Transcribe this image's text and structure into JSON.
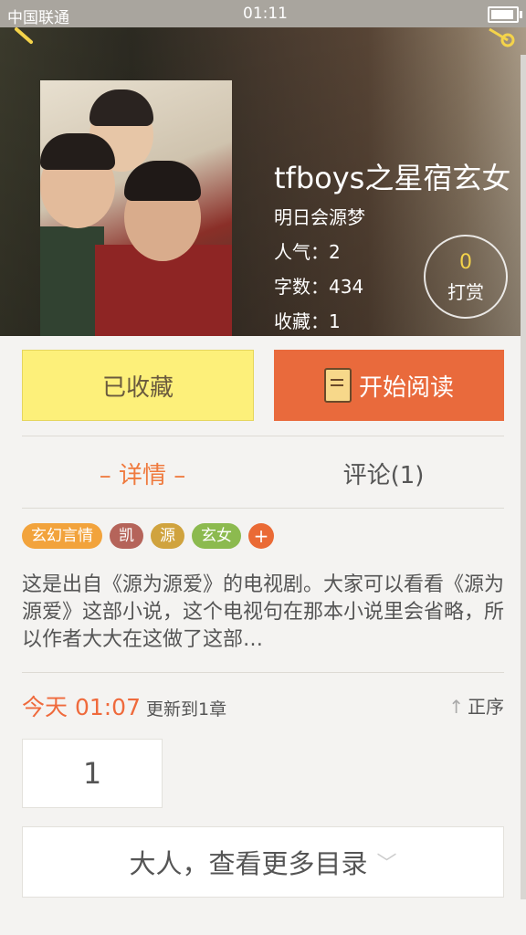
{
  "status_bar": {
    "carrier": "中国联通",
    "time": "01:11"
  },
  "book": {
    "title": "tfboys之星宿玄女",
    "author": "明日会源梦",
    "stats": {
      "popularity": "人气：2",
      "word_count": "字数：434",
      "favorites": "收藏：1"
    },
    "tip": {
      "count": "0",
      "label": "打赏"
    }
  },
  "actions": {
    "collected_label": "已收藏",
    "read_label": "开始阅读"
  },
  "tabs": [
    {
      "label": "– 详情 –"
    },
    {
      "label": "评论(1)"
    }
  ],
  "tags": [
    {
      "label": "玄幻言情",
      "color": "#f2a33c"
    },
    {
      "label": "凯",
      "color": "#b5645a"
    },
    {
      "label": "源",
      "color": "#d0a33e"
    },
    {
      "label": "玄女",
      "color": "#8cba4f"
    },
    {
      "label": "+",
      "color": "#ea6a35"
    }
  ],
  "description": "这是出自《源为源爱》的电视剧。大家可以看看《源为源爱》这部小说，这个电视句在那本小说里会省略，所以作者大大在这做了这部…",
  "update": {
    "when": "今天 01:07",
    "message": "更新到1章",
    "order_label": "正序"
  },
  "chapter": {
    "number": "1"
  },
  "more_catalog": "大人，查看更多目录"
}
